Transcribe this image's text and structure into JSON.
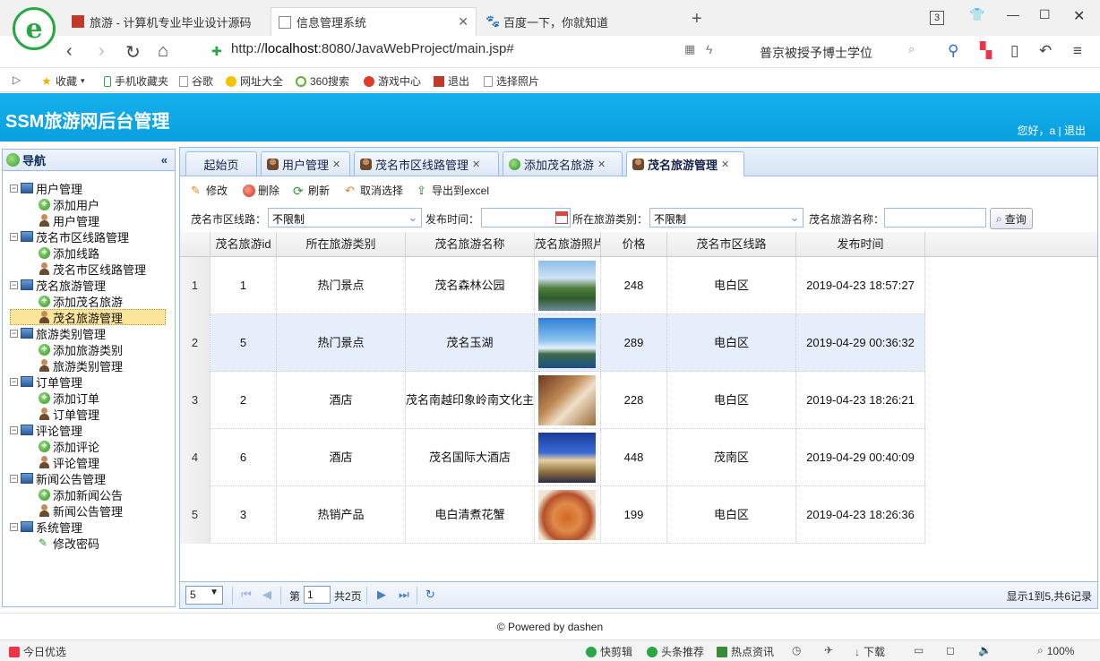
{
  "browser": {
    "tabs": [
      {
        "label": "旅游 - 计算机专业毕业设计源码"
      },
      {
        "label": "信息管理系统"
      },
      {
        "label": "百度一下，你就知道"
      }
    ],
    "tab_count": "3",
    "url_prefix": "http://",
    "url_host": "localhost",
    "url_rest": ":8080/JavaWebProject/main.jsp#",
    "search_text": "普京被授予博士学位",
    "bookmarks": [
      "收藏",
      "手机收藏夹",
      "谷歌",
      "网址大全",
      "360搜索",
      "游戏中心",
      "退出",
      "选择照片"
    ]
  },
  "app": {
    "title": "SSM旅游网后台管理",
    "user_greeting": "您好，a",
    "logout": "退出",
    "separator": "|"
  },
  "nav": {
    "title": "导航",
    "collapse": "«",
    "groups": [
      {
        "label": "用户管理",
        "items": [
          {
            "label": "添加用户",
            "icon": "add"
          },
          {
            "label": "用户管理",
            "icon": "user"
          }
        ]
      },
      {
        "label": "茂名市区线路管理",
        "items": [
          {
            "label": "添加线路",
            "icon": "add"
          },
          {
            "label": "茂名市区线路管理",
            "icon": "user"
          }
        ]
      },
      {
        "label": "茂名旅游管理",
        "items": [
          {
            "label": "添加茂名旅游",
            "icon": "add"
          },
          {
            "label": "茂名旅游管理",
            "icon": "user",
            "selected": true
          }
        ]
      },
      {
        "label": "旅游类别管理",
        "items": [
          {
            "label": "添加旅游类别",
            "icon": "add"
          },
          {
            "label": "旅游类别管理",
            "icon": "user"
          }
        ]
      },
      {
        "label": "订单管理",
        "items": [
          {
            "label": "添加订单",
            "icon": "add"
          },
          {
            "label": "订单管理",
            "icon": "user"
          }
        ]
      },
      {
        "label": "评论管理",
        "items": [
          {
            "label": "添加评论",
            "icon": "add"
          },
          {
            "label": "评论管理",
            "icon": "user"
          }
        ]
      },
      {
        "label": "新闻公告管理",
        "items": [
          {
            "label": "添加新闻公告",
            "icon": "add"
          },
          {
            "label": "新闻公告管理",
            "icon": "user"
          }
        ]
      },
      {
        "label": "系统管理",
        "items": [
          {
            "label": "修改密码",
            "icon": "pen"
          }
        ]
      }
    ]
  },
  "tabs": [
    {
      "label": "起始页",
      "closable": false
    },
    {
      "label": "用户管理",
      "closable": true
    },
    {
      "label": "茂名市区线路管理",
      "closable": true
    },
    {
      "label": "添加茂名旅游",
      "closable": true
    },
    {
      "label": "茂名旅游管理",
      "closable": true,
      "active": true
    }
  ],
  "toolbar": {
    "edit": "修改",
    "delete": "删除",
    "refresh": "刷新",
    "cancel_select": "取消选择",
    "export": "导出到excel"
  },
  "filters": {
    "line_label": "茂名市区线路：",
    "line_value": "不限制",
    "time_label": "发布时间：",
    "time_value": "",
    "type_label": "所在旅游类别：",
    "type_value": "不限制",
    "name_label": "茂名旅游名称：",
    "name_value": "",
    "query": "查询"
  },
  "grid": {
    "columns": [
      "",
      "茂名旅游id",
      "所在旅游类别",
      "茂名旅游名称",
      "茂名旅游照片",
      "价格",
      "茂名市区线路",
      "发布时间"
    ],
    "rows": [
      {
        "num": "1",
        "id": "1",
        "type": "热门景点",
        "name": "茂名森林公园",
        "photo": "park",
        "price": "248",
        "line": "电白区",
        "time": "2019-04-23 18:57:27"
      },
      {
        "num": "2",
        "id": "5",
        "type": "热门景点",
        "name": "茂名玉湖",
        "photo": "lake",
        "price": "289",
        "line": "电白区",
        "time": "2019-04-29 00:36:32"
      },
      {
        "num": "3",
        "id": "2",
        "type": "酒店",
        "name": "茂名南越印象岭南文化主",
        "photo": "hotel-room",
        "price": "228",
        "line": "电白区",
        "time": "2019-04-23 18:26:21"
      },
      {
        "num": "4",
        "id": "6",
        "type": "酒店",
        "name": "茂名国际大酒店",
        "photo": "hotel-building",
        "price": "448",
        "line": "茂南区",
        "time": "2019-04-29 00:40:09"
      },
      {
        "num": "5",
        "id": "3",
        "type": "热销产品",
        "name": "电白清煮花蟹",
        "photo": "crab",
        "price": "199",
        "line": "电白区",
        "time": "2019-04-23 18:26:36"
      }
    ]
  },
  "pager": {
    "page_size": "5",
    "page_label": "第",
    "page_value": "1",
    "total_pages": "共2页",
    "summary": "显示1到5,共6记录"
  },
  "footer": "© Powered by dashen",
  "statusbar": {
    "left": "今日优选",
    "items": [
      "快剪辑",
      "头条推荐",
      "热点资讯",
      "下载",
      "100%"
    ]
  }
}
